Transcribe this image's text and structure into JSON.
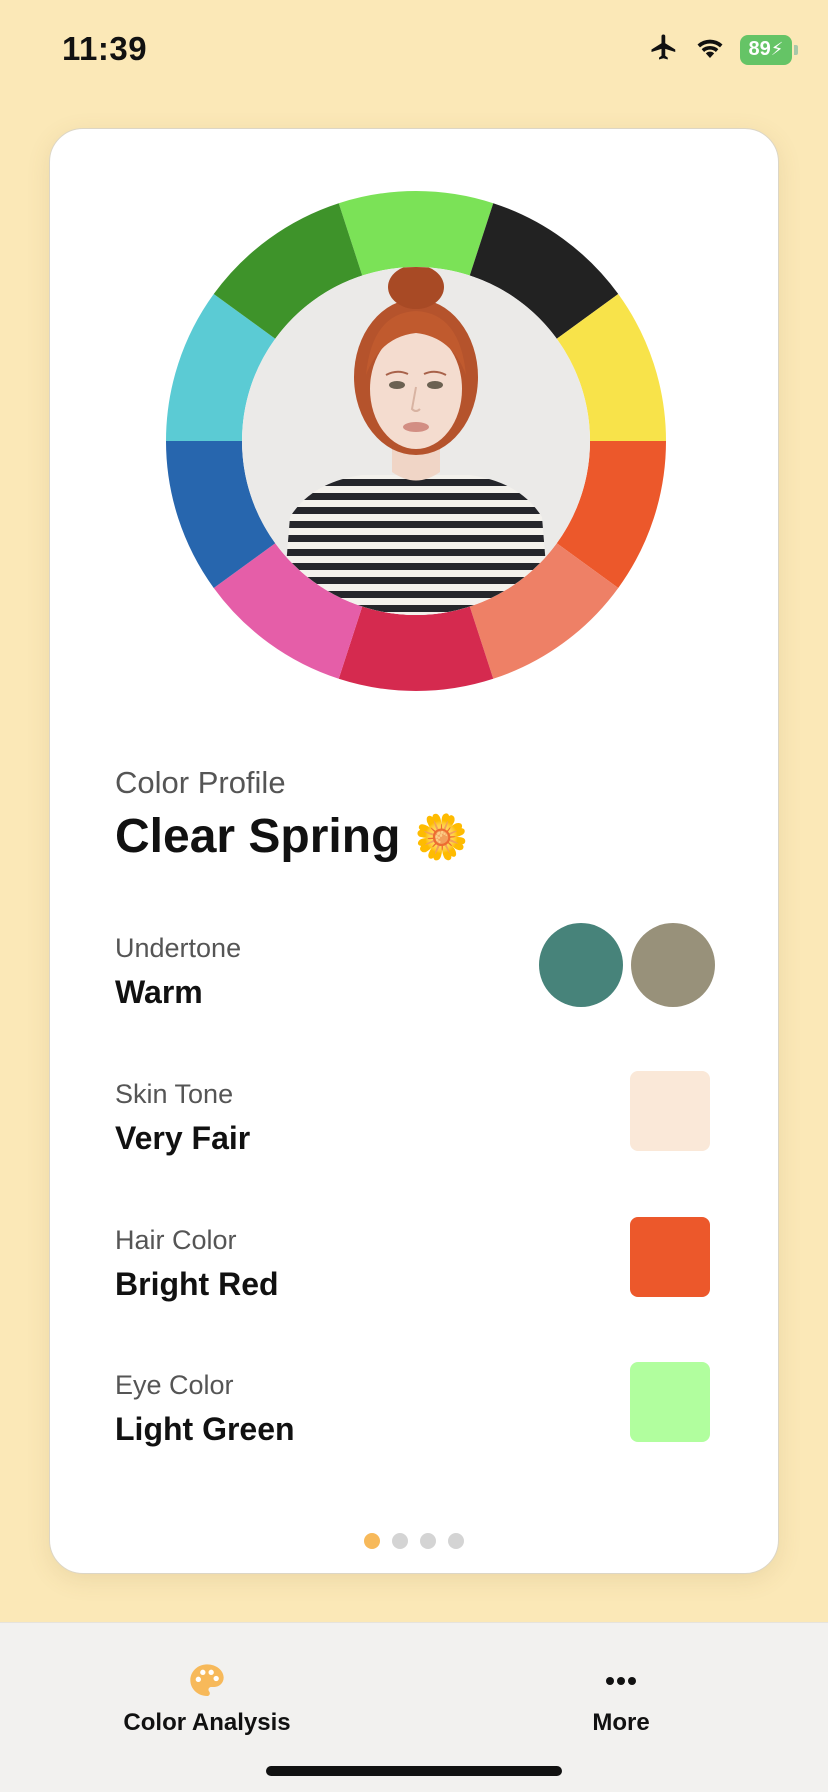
{
  "status_bar": {
    "time": "11:39",
    "battery": "89",
    "icons": [
      "airplane-icon",
      "wifi-icon",
      "battery-charging-icon"
    ]
  },
  "profile": {
    "caption": "Color Profile",
    "name": "Clear Spring",
    "emoji": "🌼"
  },
  "wheel_colors": [
    "#7be257",
    "#222222",
    "#f8e34a",
    "#ec582b",
    "#ee8066",
    "#d52a4f",
    "#e55ea8",
    "#2766ae",
    "#5bcbd4",
    "#3e932a"
  ],
  "attributes": [
    {
      "label": "Undertone",
      "value": "Warm",
      "swatches": [
        "#47837a",
        "#98917a"
      ]
    },
    {
      "label": "Skin Tone",
      "value": "Very Fair",
      "swatches": [
        "#fae8d8"
      ]
    },
    {
      "label": "Hair Color",
      "value": "Bright Red",
      "swatches": [
        "#ec582b"
      ]
    },
    {
      "label": "Eye Color",
      "value": "Light Green",
      "swatches": [
        "#b1fe9e"
      ]
    }
  ],
  "pager": {
    "count": 4,
    "active_index": 0
  },
  "tab_bar": {
    "tabs": [
      {
        "label": "Color Analysis",
        "icon": "palette-icon",
        "selected": true
      },
      {
        "label": "More",
        "icon": "more-dots-icon",
        "selected": false
      }
    ]
  },
  "accent_color": "#f7b95a"
}
